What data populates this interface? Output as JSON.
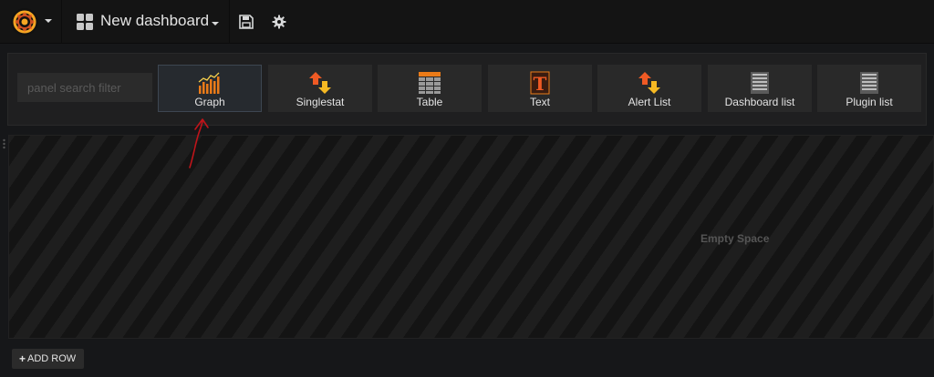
{
  "navbar": {
    "dashboard_title": "New dashboard",
    "icons": [
      "grafana-logo-icon",
      "dashboard-grid-icon",
      "save-icon",
      "gear-icon"
    ]
  },
  "picker": {
    "search_placeholder": "panel search filter",
    "panels": [
      {
        "label": "Graph",
        "icon": "graph-icon",
        "selected": true
      },
      {
        "label": "Singlestat",
        "icon": "singlestat-icon"
      },
      {
        "label": "Table",
        "icon": "table-icon"
      },
      {
        "label": "Text",
        "icon": "text-icon"
      },
      {
        "label": "Alert List",
        "icon": "alert-list-icon"
      },
      {
        "label": "Dashboard list",
        "icon": "dashboard-list-icon"
      },
      {
        "label": "Plugin list",
        "icon": "plugin-list-icon"
      }
    ]
  },
  "row": {
    "empty_label": "Empty Space"
  },
  "footer": {
    "add_row_label": "ADD ROW"
  },
  "colors": {
    "background": "#161719",
    "accent_orange": "#eb7b18",
    "annotation_red": "#c0141a"
  }
}
